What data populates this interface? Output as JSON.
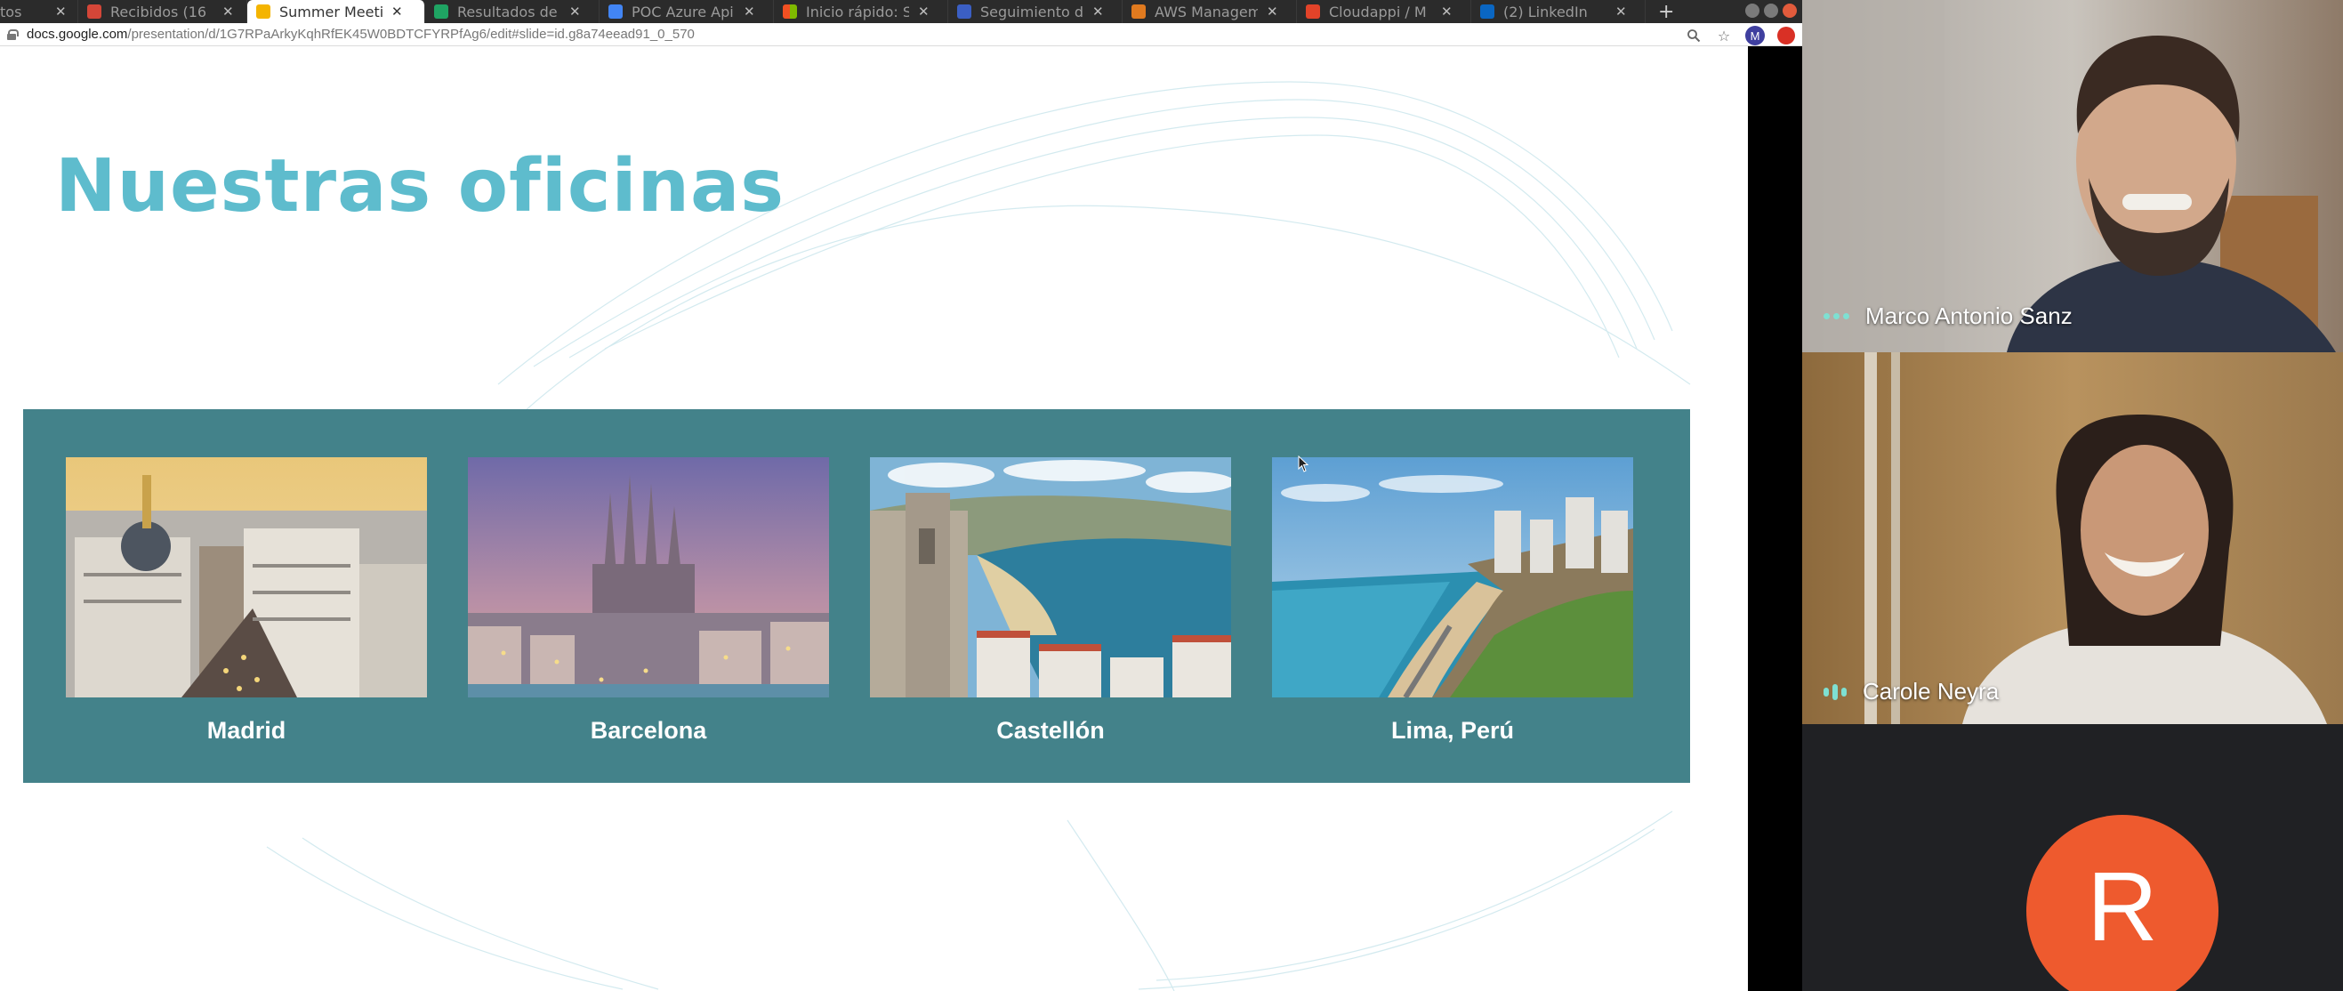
{
  "browser": {
    "tabs": [
      {
        "title": "tos",
        "icon": "partial-tab-icon",
        "color": "#777777",
        "active": false
      },
      {
        "title": "Recibidos (16",
        "icon": "gmail-icon",
        "color": "#d44638",
        "active": false
      },
      {
        "title": "Summer Meetin",
        "icon": "google-slides-icon",
        "color": "#f4b400",
        "active": true
      },
      {
        "title": "Resultados de",
        "icon": "google-drive-icon",
        "color": "#1fa463",
        "active": false
      },
      {
        "title": "POC Azure Api",
        "icon": "google-docs-icon",
        "color": "#4285f4",
        "active": false
      },
      {
        "title": "Inicio rápido: S",
        "icon": "microsoft-icon",
        "color": "#f25022",
        "active": false
      },
      {
        "title": "Seguimiento d",
        "icon": "tracker-icon",
        "color": "#3b5fc4",
        "active": false
      },
      {
        "title": "AWS Managem",
        "icon": "aws-icon",
        "color": "#e07a1f",
        "active": false
      },
      {
        "title": "Cloudappi / M",
        "icon": "gitlab-icon",
        "color": "#e24329",
        "active": false
      },
      {
        "title": "(2) LinkedIn",
        "icon": "linkedin-icon",
        "color": "#0a66c2",
        "active": false
      }
    ],
    "new_tab_label": "+",
    "url_domain": "docs.google.com",
    "url_path": "/presentation/d/1G7RPaArkyKqhRfEK45W0BDTCFYRPfAg6/edit#slide=id.g8a74eead91_0_570",
    "profile_initial": "M"
  },
  "slide": {
    "title": "Nuestras oficinas",
    "offices": [
      {
        "city": "Madrid",
        "photo": "madrid-photo"
      },
      {
        "city": "Barcelona",
        "photo": "barcelona-photo"
      },
      {
        "city": "Castellón",
        "photo": "castellon-photo"
      },
      {
        "city": "Lima, Perú",
        "photo": "lima-photo"
      }
    ],
    "colors": {
      "title": "#5ebccd",
      "panel": "#43828a"
    }
  },
  "participants": [
    {
      "name": "Marco Antonio Sanz",
      "indicator": "speaking-dots"
    },
    {
      "name": "Carole Neyra",
      "indicator": "speaking-bars"
    },
    {
      "name": "",
      "avatar_initial": "R",
      "avatar_color": "#ee5a2e"
    }
  ]
}
